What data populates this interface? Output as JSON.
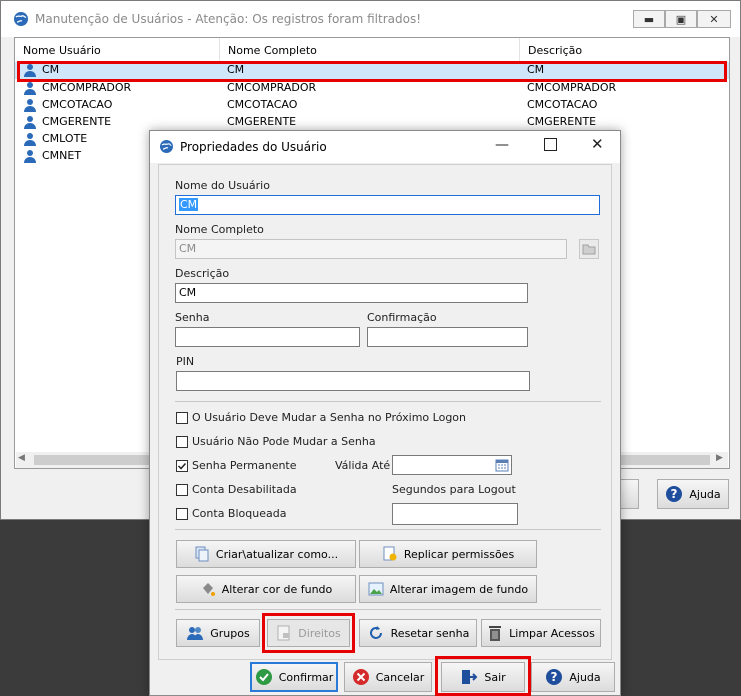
{
  "main": {
    "title": "Manutenção de Usuários - Atenção: Os registros foram filtrados!",
    "columns": [
      "Nome Usuário",
      "Nome Completo",
      "Descrição"
    ],
    "rows": [
      {
        "user": "CM",
        "full": "CM",
        "desc": "CM"
      },
      {
        "user": "CMCOMPRADOR",
        "full": "CMCOMPRADOR",
        "desc": "CMCOMPRADOR"
      },
      {
        "user": "CMCOTACAO",
        "full": "CMCOTACAO",
        "desc": "CMCOTACAO"
      },
      {
        "user": "CMGERENTE",
        "full": "CMGERENTE",
        "desc": "CMGERENTE"
      },
      {
        "user": "CMLOTE",
        "full": "",
        "desc": ""
      },
      {
        "user": "CMNET",
        "full": "",
        "desc": ""
      }
    ],
    "help_label": "Ajuda",
    "scroll_left": "◀",
    "scroll_right": "▶"
  },
  "dialog": {
    "title": "Propriedades do Usuário",
    "fields": {
      "username_label": "Nome do Usuário",
      "username_value": "CM",
      "fullname_label": "Nome Completo",
      "fullname_value": "CM",
      "description_label": "Descrição",
      "description_value": "CM",
      "password_label": "Senha",
      "confirm_label": "Confirmação",
      "pin_label": "PIN",
      "valid_until_label": "Válida Até",
      "logout_label": "Segundos para Logout"
    },
    "checkboxes": [
      {
        "label": "O Usuário Deve Mudar a Senha no Próximo Logon",
        "checked": false
      },
      {
        "label": "Usuário Não Pode Mudar a Senha",
        "checked": false
      },
      {
        "label": "Senha Permanente",
        "checked": true
      },
      {
        "label": "Conta Desabilitada",
        "checked": false
      },
      {
        "label": "Conta Bloqueada",
        "checked": false
      }
    ],
    "buttons": {
      "create": "Criar\\atualizar como...",
      "replicate": "Replicar permissões",
      "bg_color": "Alterar cor de fundo",
      "bg_image": "Alterar imagem de fundo",
      "groups": "Grupos",
      "rights": "Direitos",
      "reset_password": "Resetar senha",
      "clear_access": "Limpar Acessos",
      "confirm": "Confirmar",
      "cancel": "Cancelar",
      "exit": "Sair",
      "help": "Ajuda"
    }
  },
  "colors": {
    "highlight": "#e60000",
    "accent": "#1e6fd9"
  }
}
